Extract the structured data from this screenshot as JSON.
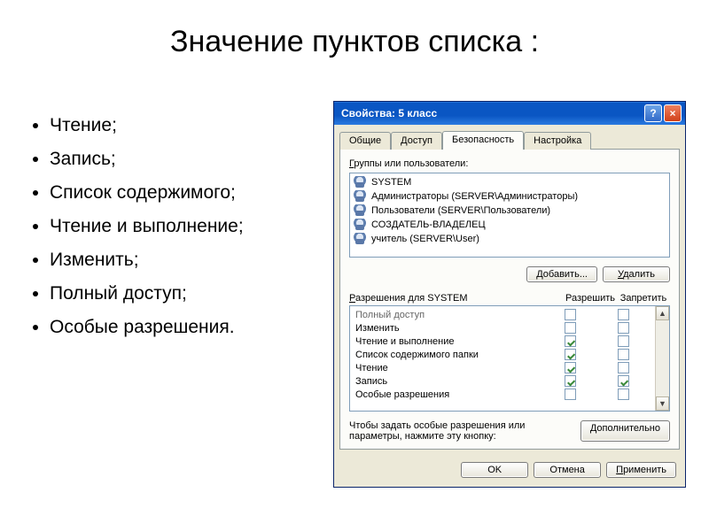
{
  "slide": {
    "title": "Значение пунктов списка :",
    "bullets": [
      "Чтение;",
      "Запись;",
      "Список содержимого;",
      "Чтение и выполнение;",
      "Изменить;",
      "Полный доступ;",
      "Особые разрешения."
    ]
  },
  "dialog": {
    "title": "Свойства: 5 класс",
    "help_glyph": "?",
    "close_glyph": "×",
    "tabs": [
      "Общие",
      "Доступ",
      "Безопасность",
      "Настройка"
    ],
    "active_tab": "Безопасность",
    "groups_label_u": "Г",
    "groups_label_rest": "руппы или пользователи:",
    "users": [
      "SYSTEM",
      "Администраторы (SERVER\\Администраторы)",
      "Пользователи (SERVER\\Пользователи)",
      "СОЗДАТЕЛЬ-ВЛАДЕЛЕЦ",
      "учитель (SERVER\\User)"
    ],
    "add_u": "Д",
    "add_rest": "обавить...",
    "remove_u": "У",
    "remove_rest": "далить",
    "perm_for_u": "Р",
    "perm_for_rest": "азрешения для SYSTEM",
    "col_allow": "Разрешить",
    "col_deny": "Запретить",
    "permissions": [
      {
        "name": "Полный доступ",
        "allow": false,
        "deny": false,
        "faded": true
      },
      {
        "name": "Изменить",
        "allow": false,
        "deny": false
      },
      {
        "name": "Чтение и выполнение",
        "allow": true,
        "deny": false
      },
      {
        "name": "Список содержимого папки",
        "allow": true,
        "deny": false
      },
      {
        "name": "Чтение",
        "allow": true,
        "deny": false
      },
      {
        "name": "Запись",
        "allow": true,
        "deny": true
      },
      {
        "name": "Особые разрешения",
        "allow": false,
        "deny": false
      }
    ],
    "helptext": "Чтобы задать особые разрешения или параметры, нажмите эту кнопку:",
    "advanced_u": "Д",
    "advanced_rest": "ополнительно",
    "ok": "OK",
    "cancel_u": "О",
    "cancel_rest": "тмена",
    "apply_u": "П",
    "apply_rest": "рименить",
    "scroll_up": "▲",
    "scroll_down": "▼"
  }
}
